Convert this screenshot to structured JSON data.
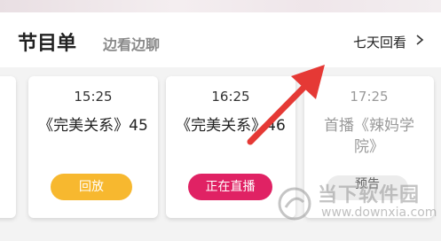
{
  "header": {
    "title": "节目单",
    "subtitle": "边看边聊",
    "seven_days": "七天回看"
  },
  "cards": [
    {
      "time": "15:25",
      "program": "《完美关系》45",
      "button": "回放"
    },
    {
      "time": "16:25",
      "program": "《完美关系》46",
      "button": "正在直播"
    },
    {
      "time": "17:25",
      "program": "首播《辣妈学院》",
      "button": "预告"
    }
  ],
  "colors": {
    "replay": "#f7b82f",
    "live": "#e02264",
    "arrow": "#e53935"
  },
  "watermark": {
    "name": "当下软件园",
    "url": "www.downxia.com"
  }
}
